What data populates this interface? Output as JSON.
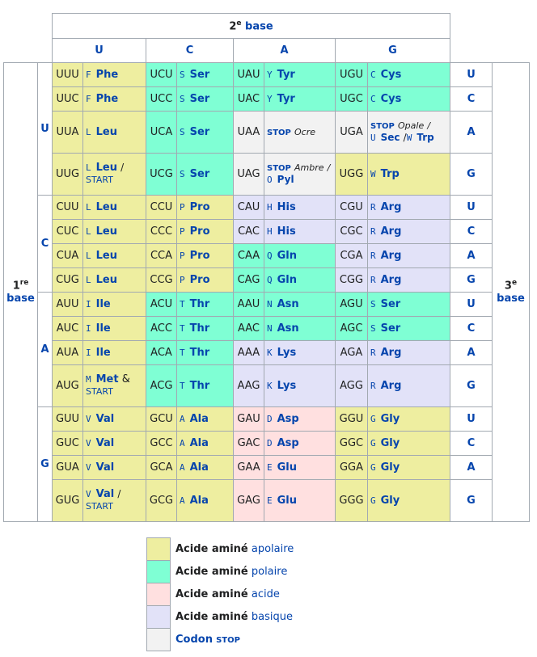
{
  "header": {
    "second_num": "2",
    "second_sup": "e",
    "second_word": "base",
    "cols": [
      "U",
      "C",
      "A",
      "G"
    ]
  },
  "side": {
    "first_num": "1",
    "first_sup": "re",
    "first_word": "base",
    "third_num": "3",
    "third_sup": "e",
    "third_word": "base",
    "groups": [
      "U",
      "C",
      "A",
      "G"
    ]
  },
  "rows": [
    {
      "third": "U",
      "c": [
        {
          "codon": "UUU",
          "l": "F",
          "aa": "Phe"
        },
        {
          "codon": "UCU",
          "l": "S",
          "aa": "Ser"
        },
        {
          "codon": "UAU",
          "l": "Y",
          "aa": "Tyr"
        },
        {
          "codon": "UGU",
          "l": "C",
          "aa": "Cys"
        }
      ]
    },
    {
      "third": "C",
      "c": [
        {
          "codon": "UUC",
          "l": "F",
          "aa": "Phe"
        },
        {
          "codon": "UCC",
          "l": "S",
          "aa": "Ser"
        },
        {
          "codon": "UAC",
          "l": "Y",
          "aa": "Tyr"
        },
        {
          "codon": "UGC",
          "l": "C",
          "aa": "Cys"
        }
      ]
    },
    {
      "third": "A",
      "c": [
        {
          "codon": "UUA",
          "l": "L",
          "aa": "Leu"
        },
        {
          "codon": "UCA",
          "l": "S",
          "aa": "Ser"
        },
        {
          "codon": "UAA",
          "stop": "STOP",
          "stopname": "Ocre"
        },
        {
          "codon": "UGA",
          "stop": "STOP",
          "stopname": "Opale",
          "slash": "/",
          "l2": "U",
          "aa2": "Sec",
          "slash2": "/",
          "l3": "W",
          "aa3": "Trp"
        }
      ]
    },
    {
      "third": "G",
      "c": [
        {
          "codon": "UUG",
          "l": "L",
          "aa": "Leu",
          "slash": "/",
          "start": "START"
        },
        {
          "codon": "UCG",
          "l": "S",
          "aa": "Ser"
        },
        {
          "codon": "UAG",
          "stop": "STOP",
          "stopname": "Ambre",
          "slash": "/",
          "l2": "O",
          "aa2": "Pyl"
        },
        {
          "codon": "UGG",
          "l": "W",
          "aa": "Trp"
        }
      ]
    },
    {
      "third": "U",
      "c": [
        {
          "codon": "CUU",
          "l": "L",
          "aa": "Leu"
        },
        {
          "codon": "CCU",
          "l": "P",
          "aa": "Pro"
        },
        {
          "codon": "CAU",
          "l": "H",
          "aa": "His"
        },
        {
          "codon": "CGU",
          "l": "R",
          "aa": "Arg"
        }
      ]
    },
    {
      "third": "C",
      "c": [
        {
          "codon": "CUC",
          "l": "L",
          "aa": "Leu"
        },
        {
          "codon": "CCC",
          "l": "P",
          "aa": "Pro"
        },
        {
          "codon": "CAC",
          "l": "H",
          "aa": "His"
        },
        {
          "codon": "CGC",
          "l": "R",
          "aa": "Arg"
        }
      ]
    },
    {
      "third": "A",
      "c": [
        {
          "codon": "CUA",
          "l": "L",
          "aa": "Leu"
        },
        {
          "codon": "CCA",
          "l": "P",
          "aa": "Pro"
        },
        {
          "codon": "CAA",
          "l": "Q",
          "aa": "Gln"
        },
        {
          "codon": "CGA",
          "l": "R",
          "aa": "Arg"
        }
      ]
    },
    {
      "third": "G",
      "c": [
        {
          "codon": "CUG",
          "l": "L",
          "aa": "Leu"
        },
        {
          "codon": "CCG",
          "l": "P",
          "aa": "Pro"
        },
        {
          "codon": "CAG",
          "l": "Q",
          "aa": "Gln"
        },
        {
          "codon": "CGG",
          "l": "R",
          "aa": "Arg"
        }
      ]
    },
    {
      "third": "U",
      "c": [
        {
          "codon": "AUU",
          "l": "I",
          "aa": "Ile"
        },
        {
          "codon": "ACU",
          "l": "T",
          "aa": "Thr"
        },
        {
          "codon": "AAU",
          "l": "N",
          "aa": "Asn"
        },
        {
          "codon": "AGU",
          "l": "S",
          "aa": "Ser"
        }
      ]
    },
    {
      "third": "C",
      "c": [
        {
          "codon": "AUC",
          "l": "I",
          "aa": "Ile"
        },
        {
          "codon": "ACC",
          "l": "T",
          "aa": "Thr"
        },
        {
          "codon": "AAC",
          "l": "N",
          "aa": "Asn"
        },
        {
          "codon": "AGC",
          "l": "S",
          "aa": "Ser"
        }
      ]
    },
    {
      "third": "A",
      "c": [
        {
          "codon": "AUA",
          "l": "I",
          "aa": "Ile"
        },
        {
          "codon": "ACA",
          "l": "T",
          "aa": "Thr"
        },
        {
          "codon": "AAA",
          "l": "K",
          "aa": "Lys"
        },
        {
          "codon": "AGA",
          "l": "R",
          "aa": "Arg"
        }
      ]
    },
    {
      "third": "G",
      "c": [
        {
          "codon": "AUG",
          "l": "M",
          "aa": "Met",
          "amp": "&",
          "start": "START"
        },
        {
          "codon": "ACG",
          "l": "T",
          "aa": "Thr"
        },
        {
          "codon": "AAG",
          "l": "K",
          "aa": "Lys"
        },
        {
          "codon": "AGG",
          "l": "R",
          "aa": "Arg"
        }
      ]
    },
    {
      "third": "U",
      "c": [
        {
          "codon": "GUU",
          "l": "V",
          "aa": "Val"
        },
        {
          "codon": "GCU",
          "l": "A",
          "aa": "Ala"
        },
        {
          "codon": "GAU",
          "l": "D",
          "aa": "Asp"
        },
        {
          "codon": "GGU",
          "l": "G",
          "aa": "Gly"
        }
      ]
    },
    {
      "third": "C",
      "c": [
        {
          "codon": "GUC",
          "l": "V",
          "aa": "Val"
        },
        {
          "codon": "GCC",
          "l": "A",
          "aa": "Ala"
        },
        {
          "codon": "GAC",
          "l": "D",
          "aa": "Asp"
        },
        {
          "codon": "GGC",
          "l": "G",
          "aa": "Gly"
        }
      ]
    },
    {
      "third": "A",
      "c": [
        {
          "codon": "GUA",
          "l": "V",
          "aa": "Val"
        },
        {
          "codon": "GCA",
          "l": "A",
          "aa": "Ala"
        },
        {
          "codon": "GAA",
          "l": "E",
          "aa": "Glu"
        },
        {
          "codon": "GGA",
          "l": "G",
          "aa": "Gly"
        }
      ]
    },
    {
      "third": "G",
      "c": [
        {
          "codon": "GUG",
          "l": "V",
          "aa": "Val",
          "slash": "/",
          "start": "START"
        },
        {
          "codon": "GCG",
          "l": "A",
          "aa": "Ala"
        },
        {
          "codon": "GAG",
          "l": "E",
          "aa": "Glu"
        },
        {
          "codon": "GGG",
          "l": "G",
          "aa": "Gly"
        }
      ]
    }
  ],
  "legend": {
    "prefix": "Acide aminé",
    "items": [
      "apolaire",
      "polaire",
      "acide",
      "basique"
    ],
    "codon_word": "Codon",
    "codon_stop": "STOP"
  },
  "colors": {
    "apolaire": "#eeeea0",
    "polaire": "#7fffd4",
    "acide": "#ffe0e0",
    "basique": "#e2e2f8",
    "stop": "#f2f2f2",
    "link": "#0645ad",
    "border": "#a2a9b1"
  }
}
